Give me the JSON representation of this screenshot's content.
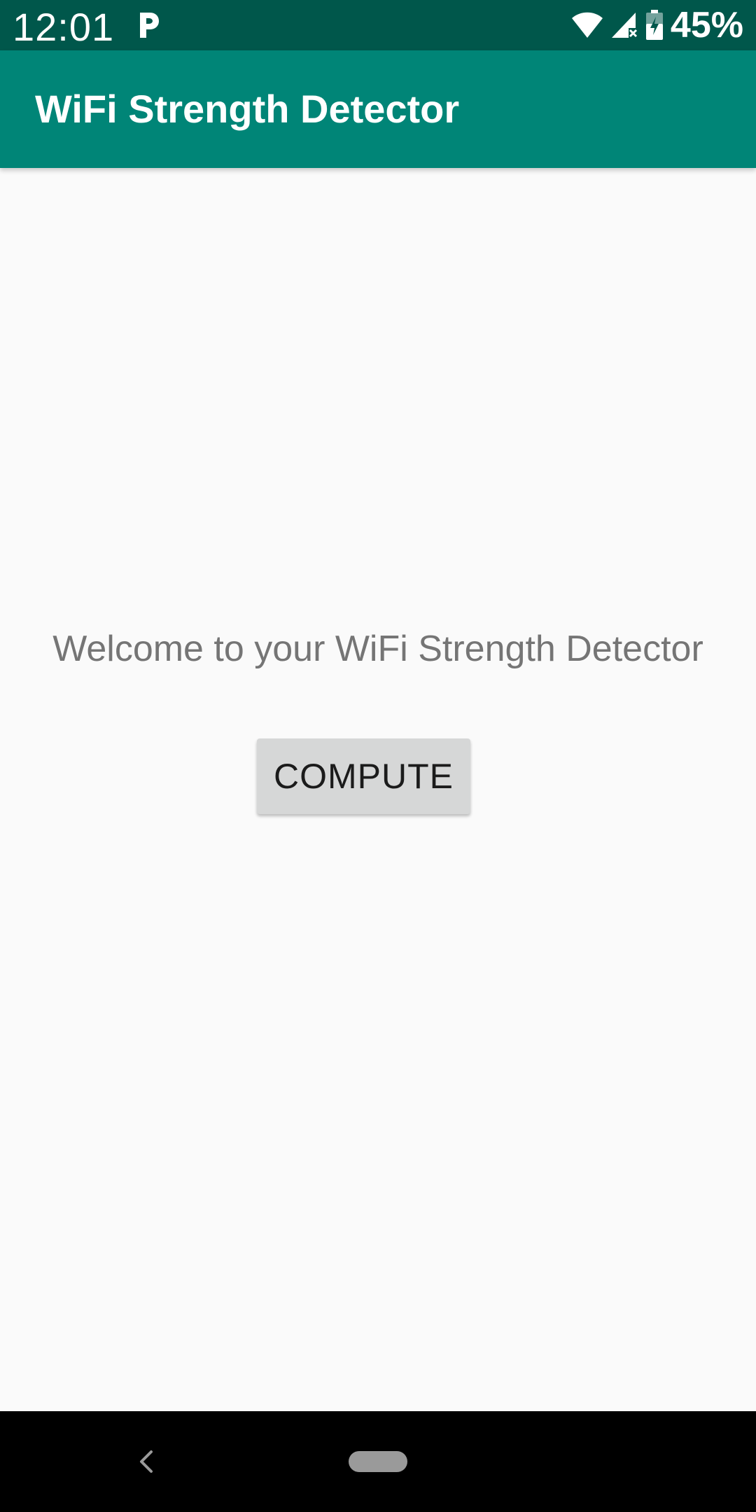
{
  "status_bar": {
    "time": "12:01",
    "notification_icon": "parking-p-icon",
    "wifi_icon": "wifi-icon",
    "signal_icon": "cell-signal-no-service-icon",
    "battery_icon": "battery-charging-icon",
    "battery_percent": "45%"
  },
  "app_bar": {
    "title": "WiFi Strength Detector"
  },
  "main": {
    "welcome_text": "Welcome to your WiFi Strength Detector",
    "compute_button_label": "COMPUTE"
  },
  "nav_bar": {
    "back_icon": "back-chevron-icon",
    "home_icon": "home-pill-icon"
  },
  "colors": {
    "status_bar": "#00574b",
    "app_bar": "#008577",
    "background": "#fafafa",
    "button": "#d6d7d7",
    "welcome_text": "#757575"
  }
}
